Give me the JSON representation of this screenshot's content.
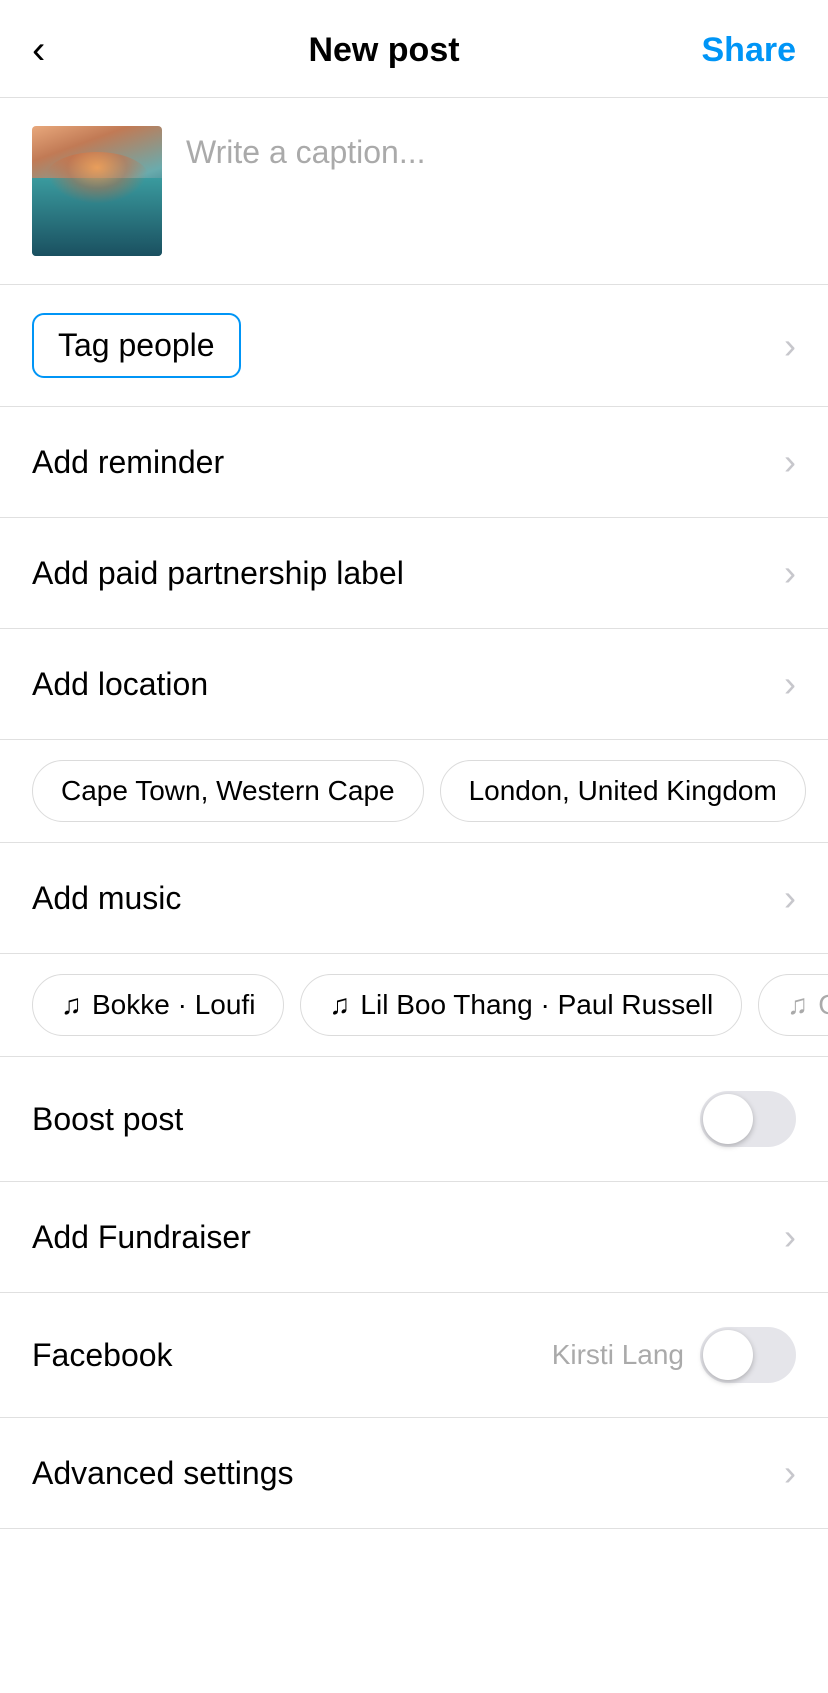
{
  "header": {
    "back_label": "‹",
    "title": "New post",
    "share_label": "Share"
  },
  "caption": {
    "placeholder": "Write a caption..."
  },
  "menu_items": [
    {
      "id": "tag-people",
      "label": "Tag people",
      "highlighted": true
    },
    {
      "id": "add-reminder",
      "label": "Add reminder"
    },
    {
      "id": "add-paid-partnership",
      "label": "Add paid partnership label"
    },
    {
      "id": "add-location",
      "label": "Add location"
    }
  ],
  "location_chips": [
    {
      "id": "cape-town",
      "label": "Cape Town, Western Cape"
    },
    {
      "id": "london",
      "label": "London, United Kingdom"
    }
  ],
  "add_music": {
    "label": "Add music"
  },
  "music_chips": [
    {
      "id": "bokke",
      "label": "Bokke · Loufi",
      "icon": "♫"
    },
    {
      "id": "lil-boo-thang",
      "label": "Lil Boo Thang · Paul Russell",
      "icon": "♫"
    },
    {
      "id": "go",
      "label": "Go",
      "icon": "♫"
    }
  ],
  "toggles": [
    {
      "id": "boost-post",
      "label": "Boost post",
      "has_sublabel": false,
      "sublabel": "",
      "enabled": false
    },
    {
      "id": "facebook",
      "label": "Facebook",
      "has_sublabel": true,
      "sublabel": "Kirsti Lang",
      "enabled": false
    }
  ],
  "list_items_below": [
    {
      "id": "add-fundraiser",
      "label": "Add Fundraiser"
    },
    {
      "id": "advanced-settings",
      "label": "Advanced settings"
    }
  ]
}
